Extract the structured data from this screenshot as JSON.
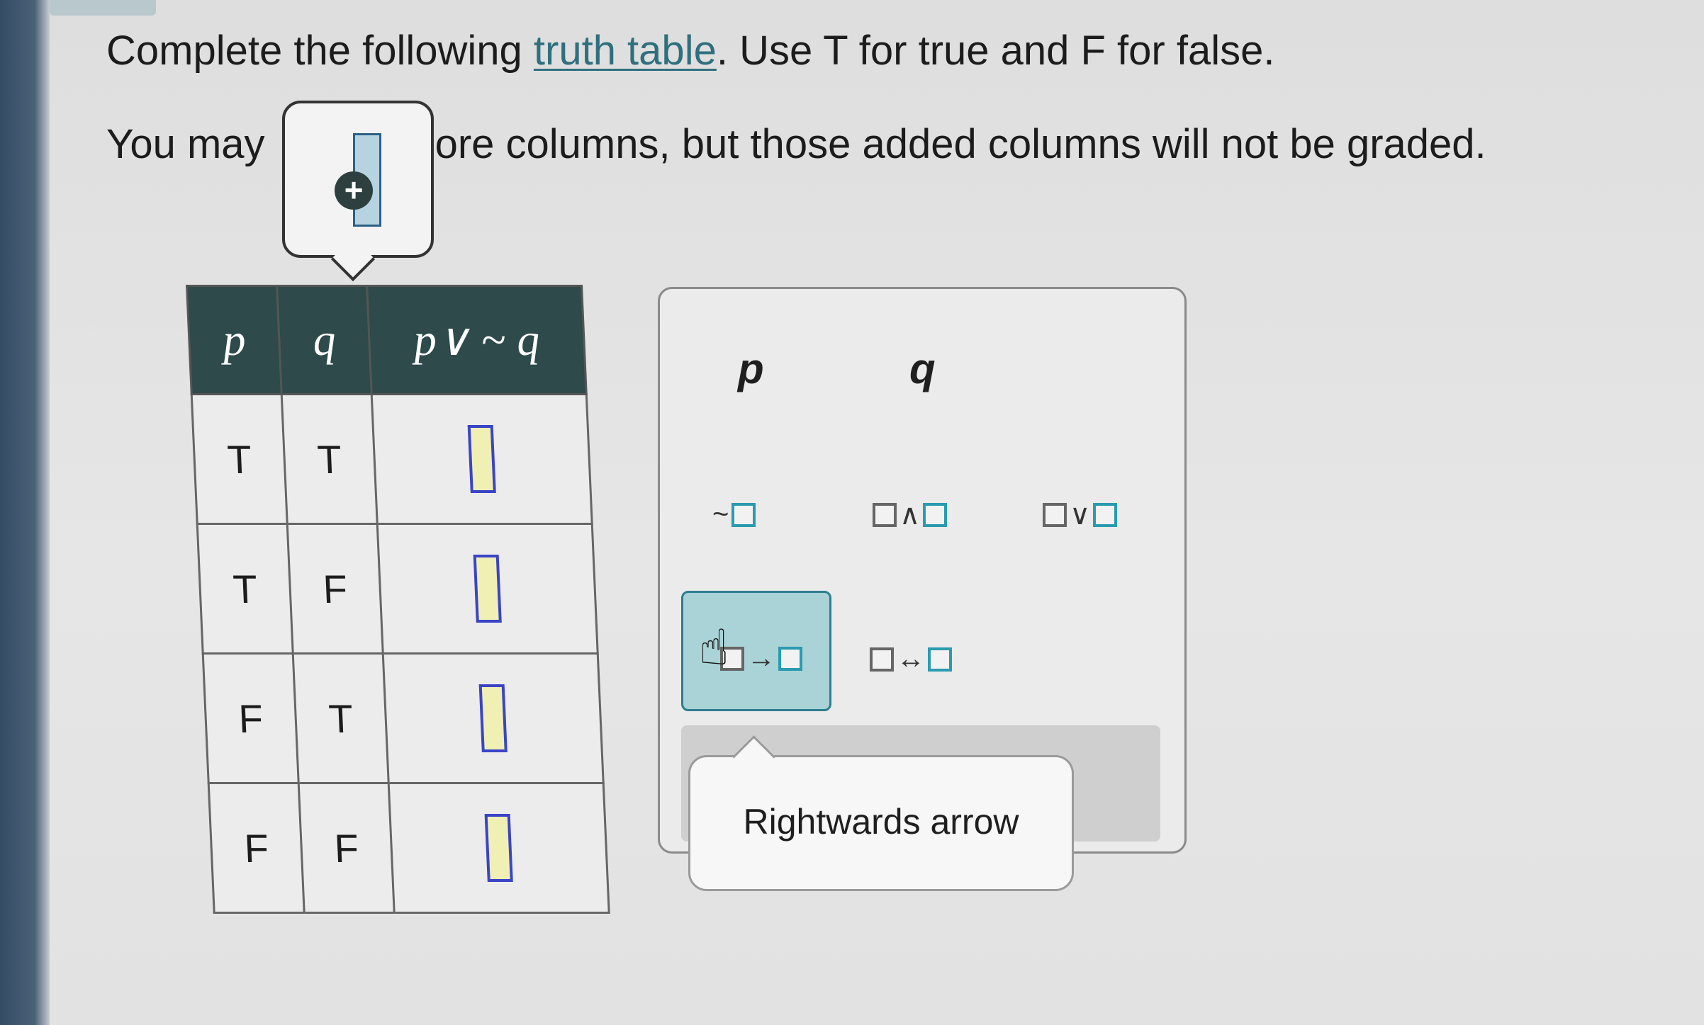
{
  "instructions": {
    "line1_before": "Complete the following ",
    "line1_link": "truth table",
    "line1_after": ". Use T for true and F for false.",
    "line2_start": "You may",
    "line2_end": "ore columns, but those added columns will not be graded."
  },
  "table": {
    "headers": [
      "p",
      "q",
      "p∨ ~ q"
    ],
    "rows": [
      [
        "T",
        "T"
      ],
      [
        "T",
        "F"
      ],
      [
        "F",
        "T"
      ],
      [
        "F",
        "F"
      ]
    ]
  },
  "palette": {
    "var_p": "p",
    "var_q": "q",
    "not_op": "~",
    "and_op": "∧",
    "or_op": "∨",
    "implies_op": "→",
    "biconditional_op": "↔"
  },
  "tooltip": {
    "text": "Rightwards arrow"
  },
  "colors": {
    "header_bg": "#2e4a4a",
    "link": "#2f6f7e",
    "selected": "#a9d3d6",
    "answer_border": "#3a44c8"
  }
}
